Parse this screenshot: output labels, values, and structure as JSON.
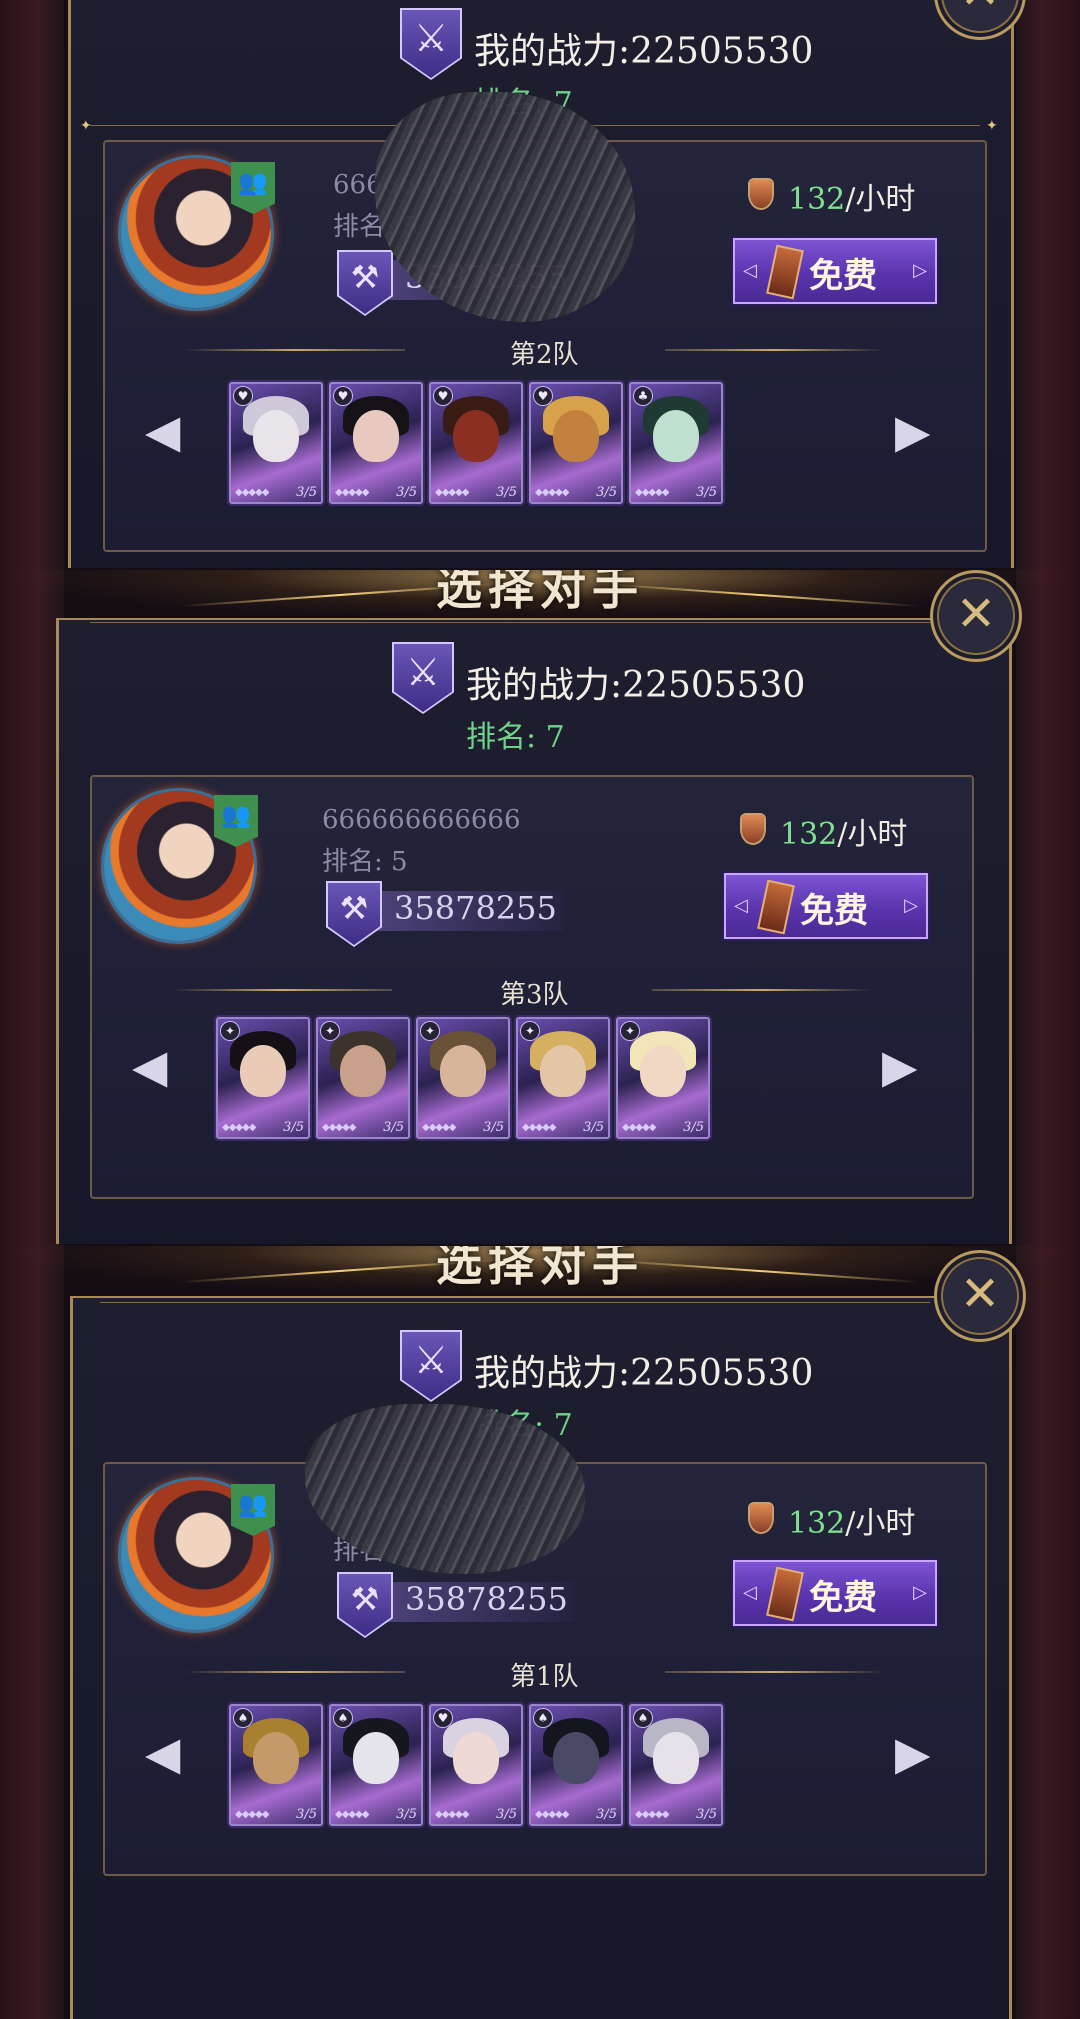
{
  "screens": [
    {
      "header_title": "",
      "my_power_label": "我的战力:22505530",
      "my_rank_label": "排名: 7",
      "opponent": {
        "name": "666666666666",
        "rank": "排名: 5",
        "power": "35878255",
        "obscured": true
      },
      "income_value": "132",
      "income_unit": "/小时",
      "free_button": "免费",
      "team_label": "第2队",
      "heroes": [
        {
          "element": "heart-icon",
          "glyph": "♥",
          "level": "3/5",
          "colors": [
            "#e8e4ea",
            "#cfc8d8"
          ]
        },
        {
          "element": "heart-icon",
          "glyph": "♥",
          "level": "3/5",
          "colors": [
            "#e9c9bf",
            "#151218"
          ]
        },
        {
          "element": "heart-icon",
          "glyph": "♥",
          "level": "3/5",
          "colors": [
            "#8a2f22",
            "#3a1c16"
          ]
        },
        {
          "element": "heart-icon",
          "glyph": "♥",
          "level": "3/5",
          "colors": [
            "#c2813e",
            "#d8a24a"
          ]
        },
        {
          "element": "clover-icon",
          "glyph": "♣",
          "level": "3/5",
          "colors": [
            "#bfe0cf",
            "#1f3a32"
          ]
        }
      ]
    },
    {
      "header_title": "选择对手",
      "my_power_label": "我的战力:22505530",
      "my_rank_label": "排名: 7",
      "opponent": {
        "name": "666666666666",
        "rank": "排名: 5",
        "power": "35878255",
        "obscured": false
      },
      "income_value": "132",
      "income_unit": "/小时",
      "free_button": "免费",
      "team_label": "第3队",
      "heroes": [
        {
          "element": "star-icon",
          "glyph": "✦",
          "level": "3/5",
          "colors": [
            "#e9cbb8",
            "#141016"
          ]
        },
        {
          "element": "star-icon",
          "glyph": "✦",
          "level": "3/5",
          "colors": [
            "#c9a08a",
            "#3b332c"
          ]
        },
        {
          "element": "star-icon",
          "glyph": "✦",
          "level": "3/5",
          "colors": [
            "#d8b59a",
            "#6a5236"
          ]
        },
        {
          "element": "star-icon",
          "glyph": "✦",
          "level": "3/5",
          "colors": [
            "#e3c6a6",
            "#d4b060"
          ]
        },
        {
          "element": "star-icon",
          "glyph": "✦",
          "level": "3/5",
          "colors": [
            "#f1d8c4",
            "#f2e6b8"
          ]
        }
      ]
    },
    {
      "header_title": "选择对手",
      "my_power_label": "我的战力:22505530",
      "my_rank_label": "排名: 7",
      "opponent": {
        "name": "666666666666",
        "rank": "排名: 5",
        "power": "35878255",
        "obscured": true
      },
      "income_value": "132",
      "income_unit": "/小时",
      "free_button": "免费",
      "team_label": "第1队",
      "heroes": [
        {
          "element": "spade-icon",
          "glyph": "♠",
          "level": "3/5",
          "colors": [
            "#c49a6a",
            "#a88030"
          ]
        },
        {
          "element": "spade-icon",
          "glyph": "♠",
          "level": "3/5",
          "colors": [
            "#e4e4ea",
            "#16161e"
          ]
        },
        {
          "element": "heart-icon",
          "glyph": "♥",
          "level": "3/5",
          "colors": [
            "#efd9d4",
            "#d9d2e0"
          ]
        },
        {
          "element": "spade-icon",
          "glyph": "♠",
          "level": "3/5",
          "colors": [
            "#4b4a66",
            "#15151f"
          ]
        },
        {
          "element": "spade-icon",
          "glyph": "♠",
          "level": "3/5",
          "colors": [
            "#e7e1ea",
            "#b9b6c6"
          ]
        }
      ]
    }
  ]
}
